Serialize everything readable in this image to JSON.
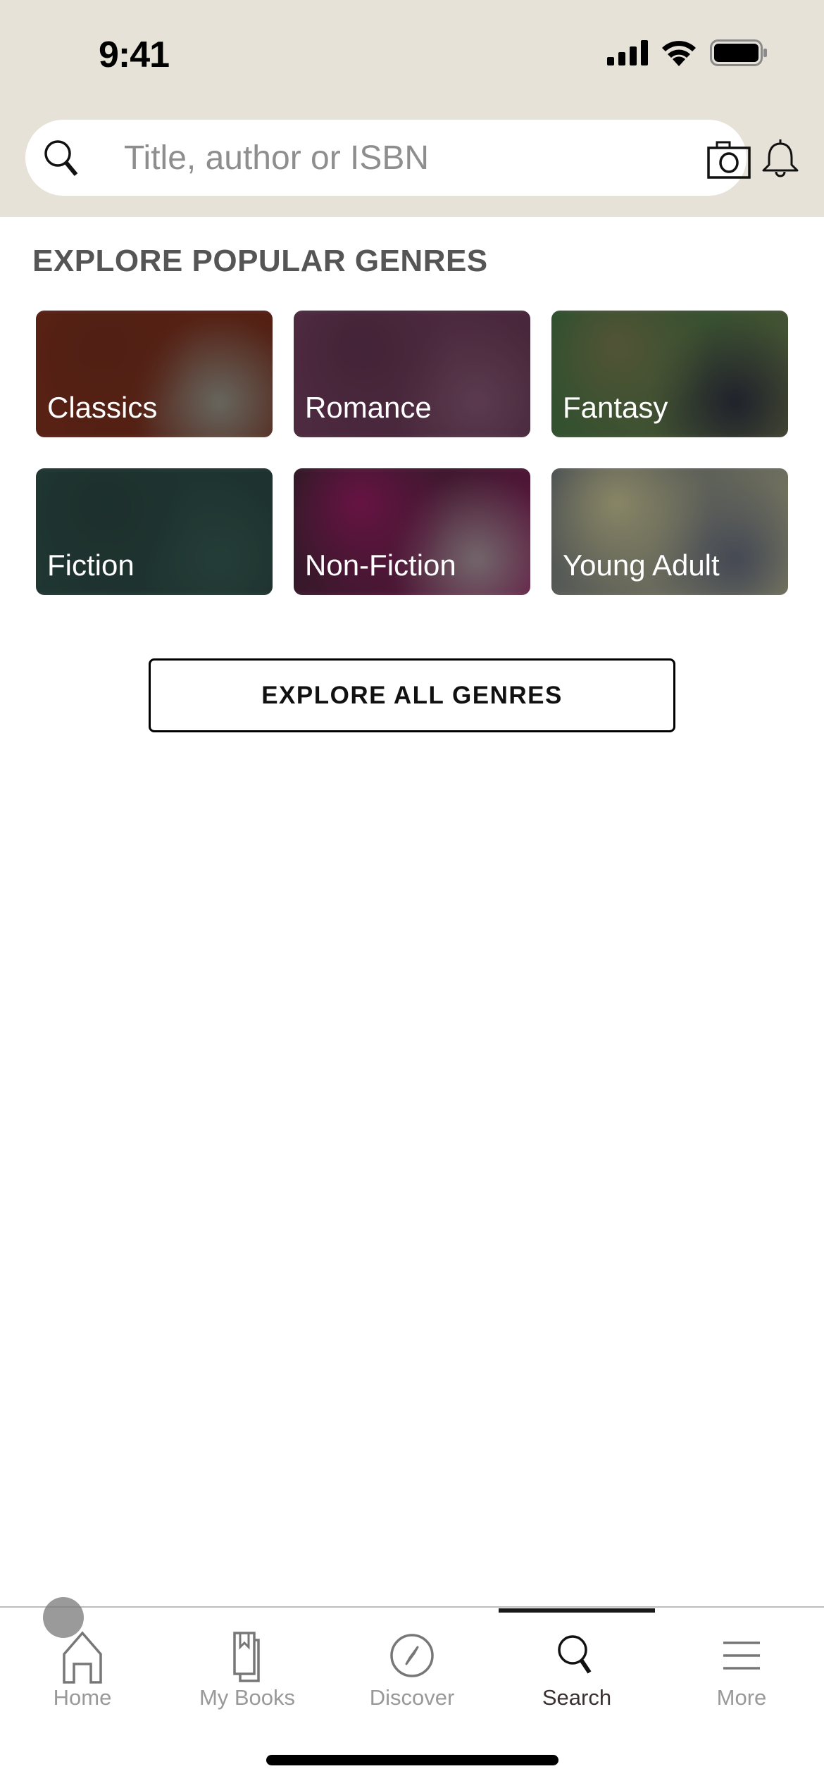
{
  "status_bar": {
    "time": "9:41",
    "icons": [
      "cellular-signal-icon",
      "wifi-icon",
      "battery-icon"
    ]
  },
  "header": {
    "search": {
      "placeholder": "Title, author or ISBN",
      "value": "",
      "leading_icon": "search-icon",
      "trailing_icon": "camera-icon"
    },
    "notifications_icon": "bell-icon",
    "background_color": "#e6e2d8"
  },
  "main": {
    "section_title": "EXPLORE POPULAR GENRES",
    "genres": [
      {
        "label": "Classics",
        "colors": [
          "#7a2d1c",
          "#6b2a1a",
          "#8a8a80"
        ]
      },
      {
        "label": "Romance",
        "colors": [
          "#6e3d5a",
          "#5a2f4a",
          "#7a4f6a"
        ]
      },
      {
        "label": "Fantasy",
        "colors": [
          "#2f6a3a",
          "#6e7048",
          "#2a2c3a"
        ]
      },
      {
        "label": "Fiction",
        "colors": [
          "#2c4c46",
          "#263f3b",
          "#31524b"
        ]
      },
      {
        "label": "Non-Fiction",
        "colors": [
          "#2a2528",
          "#8a1a5a",
          "#9a8a90"
        ]
      },
      {
        "label": "Young Adult",
        "colors": [
          "#4e5868",
          "#b8b488",
          "#5a6070"
        ]
      }
    ],
    "explore_all_label": "EXPLORE ALL GENRES"
  },
  "tabbar": {
    "active": "Search",
    "tabs": [
      {
        "label": "Home",
        "icon": "home-icon"
      },
      {
        "label": "My Books",
        "icon": "books-icon"
      },
      {
        "label": "Discover",
        "icon": "compass-icon"
      },
      {
        "label": "Search",
        "icon": "search-icon"
      },
      {
        "label": "More",
        "icon": "menu-icon"
      }
    ]
  }
}
